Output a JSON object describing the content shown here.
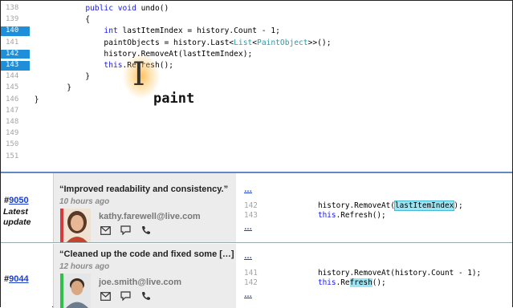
{
  "editor": {
    "lines": [
      {
        "num": "138",
        "highlight": false,
        "parts": [
          {
            "t": "            "
          },
          {
            "t": "public",
            "c": "kw"
          },
          {
            "t": " "
          },
          {
            "t": "void",
            "c": "kw"
          },
          {
            "t": " undo()"
          }
        ]
      },
      {
        "num": "139",
        "highlight": false,
        "parts": [
          {
            "t": "            {"
          }
        ]
      },
      {
        "num": "140",
        "highlight": true,
        "parts": [
          {
            "t": "                "
          },
          {
            "t": "int",
            "c": "kw"
          },
          {
            "t": " lastItemIndex = history.Count - 1;"
          }
        ]
      },
      {
        "num": "141",
        "highlight": false,
        "parts": [
          {
            "t": "                paintObjects = history.Last<"
          },
          {
            "t": "List",
            "c": "ty"
          },
          {
            "t": "<"
          },
          {
            "t": "PaintObject",
            "c": "ty"
          },
          {
            "t": ">>();"
          }
        ]
      },
      {
        "num": "142",
        "highlight": true,
        "parts": [
          {
            "t": "                history.RemoveAt(lastItemIndex);"
          }
        ]
      },
      {
        "num": "143",
        "highlight": true,
        "parts": [
          {
            "t": "                "
          },
          {
            "t": "this",
            "c": "kw"
          },
          {
            "t": ".Refresh();"
          }
        ]
      },
      {
        "num": "144",
        "highlight": false,
        "parts": [
          {
            "t": "            }"
          }
        ]
      },
      {
        "num": "145",
        "highlight": false,
        "parts": [
          {
            "t": "        }"
          }
        ]
      },
      {
        "num": "146",
        "highlight": false,
        "parts": [
          {
            "t": " }"
          }
        ]
      },
      {
        "num": "147",
        "highlight": false,
        "parts": []
      },
      {
        "num": "148",
        "highlight": false,
        "parts": []
      },
      {
        "num": "149",
        "highlight": false,
        "parts": []
      },
      {
        "num": "150",
        "highlight": false,
        "parts": []
      },
      {
        "num": "151",
        "highlight": false,
        "parts": []
      }
    ],
    "hover_label": "paint"
  },
  "history": {
    "entries": [
      {
        "id": "9050",
        "latest_label": "Latest update",
        "message": "“Improved readability and consistency.”",
        "time_ago": "10 hours ago",
        "email": "kathy.farewell@live.com",
        "avatar_accent": "#d63a3a",
        "diff": {
          "ellipsis_top": "…",
          "ellipsis_bottom": "…",
          "lines": [
            {
              "num": "142",
              "before": "history.RemoveAt(",
              "hl": "lastItemIndex",
              "after": ");",
              "hlstyle": "box"
            },
            {
              "num": "143",
              "before": "",
              "kw": "this",
              "rest": ".Refresh();"
            }
          ]
        }
      },
      {
        "id": "9044",
        "latest_label": "",
        "message": "“Cleaned up the code and fixed some […]",
        "time_ago": "12 hours ago",
        "email": "joe.smith@live.com",
        "avatar_accent": "#2fbf4a",
        "diff": {
          "ellipsis_top": "…",
          "ellipsis_bottom": "…",
          "lines": [
            {
              "num": "141",
              "before": "history.RemoveAt(history.Count - 1);"
            },
            {
              "num": "142",
              "before": "",
              "kw": "this",
              "rest_pre": ".Re",
              "hl": "fresh",
              "rest_post": "();",
              "hlstyle": "fill"
            }
          ]
        }
      }
    ],
    "icons": [
      "mail-icon",
      "chat-icon",
      "phone-icon"
    ]
  },
  "colors": {
    "line_highlight": "#1e8fd8",
    "keyword": "#1a1ae6",
    "type": "#2a9aa8",
    "divider": "#5e88c6",
    "diff_highlight": "#9ce6f4"
  }
}
